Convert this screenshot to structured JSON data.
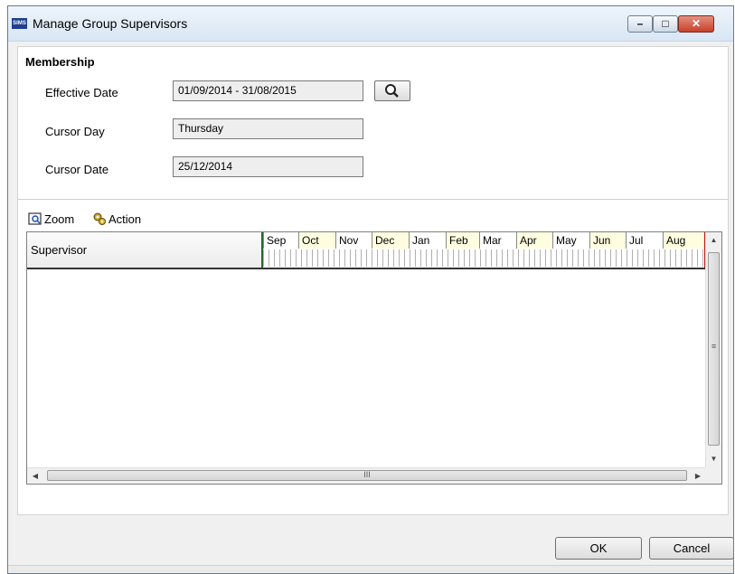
{
  "window": {
    "title": "Manage Group Supervisors",
    "app_icon_text": "SIMS"
  },
  "membership": {
    "group_title": "Membership",
    "effective_date": {
      "label": "Effective Date",
      "value": "01/09/2014 - 31/08/2015"
    },
    "cursor_day": {
      "label": "Cursor Day",
      "value": "Thursday"
    },
    "cursor_date": {
      "label": "Cursor Date",
      "value": "25/12/2014"
    }
  },
  "toolbar": {
    "zoom_label": "Zoom",
    "action_label": "Action"
  },
  "grid": {
    "column_header": "Supervisor",
    "months": [
      "Sep",
      "Oct",
      "Nov",
      "Dec",
      "Jan",
      "Feb",
      "Mar",
      "Apr",
      "May",
      "Jun",
      "Jul",
      "Aug"
    ],
    "hscroll_grip": "III",
    "vscroll_grip": "≡"
  },
  "buttons": {
    "ok_label": "OK",
    "cancel_label": "Cancel"
  },
  "colors": {
    "month_highlight": "#fffde0",
    "start_marker": "#1f6b2a",
    "end_marker": "#b01818"
  }
}
